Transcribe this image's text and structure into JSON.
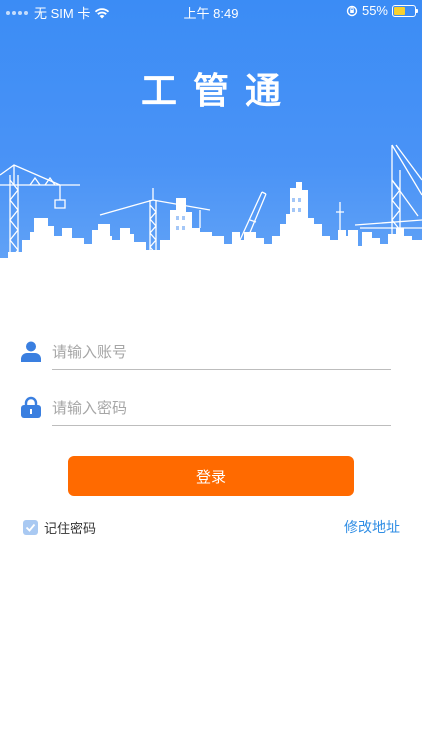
{
  "status_bar": {
    "carrier": "无 SIM 卡",
    "time": "上午 8:49",
    "battery_percent": "55%",
    "battery_level": 0.55,
    "icons": [
      "wifi-icon",
      "orientation-lock-icon",
      "battery-icon"
    ]
  },
  "header": {
    "title": "工管通",
    "illustration": "city-skyline-with-cranes"
  },
  "form": {
    "account": {
      "value": "",
      "placeholder": "请输入账号",
      "icon": "user-icon"
    },
    "password": {
      "value": "",
      "placeholder": "请输入密码",
      "icon": "lock-icon"
    },
    "login_label": "登录",
    "remember_label": "记住密码",
    "remember_checked": true,
    "modify_address_label": "修改地址"
  },
  "colors": {
    "header_blue": "#3b8cf5",
    "button_orange": "#ff6a00",
    "link_blue": "#2f8de4",
    "icon_blue": "#3a7fe0"
  }
}
